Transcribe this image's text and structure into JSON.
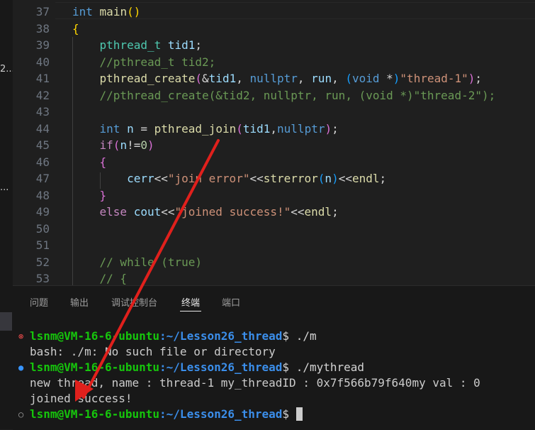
{
  "sidebar": {
    "fragments": [
      "2...",
      "..."
    ]
  },
  "editor": {
    "lines": [
      {
        "n": "37",
        "tokens": [
          [
            "int",
            "k"
          ],
          [
            " ",
            "p"
          ],
          [
            "main",
            "f"
          ],
          [
            "()",
            "py"
          ]
        ]
      },
      {
        "n": "38",
        "tokens": [
          [
            "{",
            "py"
          ]
        ]
      },
      {
        "n": "39",
        "tokens": [
          [
            "    ",
            "p"
          ],
          [
            "pthread_t",
            "t"
          ],
          [
            " ",
            "p"
          ],
          [
            "tid1",
            "v"
          ],
          [
            ";",
            "p"
          ]
        ]
      },
      {
        "n": "40",
        "tokens": [
          [
            "    ",
            "p"
          ],
          [
            "//pthread_t tid2;",
            "c"
          ]
        ]
      },
      {
        "n": "41",
        "tokens": [
          [
            "    ",
            "p"
          ],
          [
            "pthread_create",
            "f"
          ],
          [
            "(",
            "pb"
          ],
          [
            "&",
            "p"
          ],
          [
            "tid1",
            "v"
          ],
          [
            ", ",
            "p"
          ],
          [
            "nullptr",
            "k"
          ],
          [
            ", ",
            "p"
          ],
          [
            "run",
            "v"
          ],
          [
            ", ",
            "p"
          ],
          [
            "(",
            "pbl"
          ],
          [
            "void",
            "k"
          ],
          [
            " *",
            "p"
          ],
          [
            ")",
            "pbl"
          ],
          [
            "\"thread-1\"",
            "s"
          ],
          [
            ")",
            "pb"
          ],
          [
            ";",
            "p"
          ]
        ]
      },
      {
        "n": "42",
        "tokens": [
          [
            "    ",
            "p"
          ],
          [
            "//pthread_create(&tid2, nullptr, run, (void *)\"thread-2\");",
            "c"
          ]
        ]
      },
      {
        "n": "43",
        "tokens": []
      },
      {
        "n": "44",
        "tokens": [
          [
            "    ",
            "p"
          ],
          [
            "int",
            "k"
          ],
          [
            " ",
            "p"
          ],
          [
            "n",
            "v"
          ],
          [
            " = ",
            "p"
          ],
          [
            "pthread_join",
            "f"
          ],
          [
            "(",
            "pb"
          ],
          [
            "tid1",
            "v"
          ],
          [
            ",",
            "p"
          ],
          [
            "nullptr",
            "k"
          ],
          [
            ")",
            "pb"
          ],
          [
            ";",
            "p"
          ]
        ]
      },
      {
        "n": "45",
        "tokens": [
          [
            "    ",
            "p"
          ],
          [
            "if",
            "kc"
          ],
          [
            "(",
            "pb"
          ],
          [
            "n",
            "v"
          ],
          [
            "!=",
            "p"
          ],
          [
            "0",
            "n"
          ],
          [
            ")",
            "pb"
          ]
        ]
      },
      {
        "n": "46",
        "tokens": [
          [
            "    ",
            "p"
          ],
          [
            "{",
            "pb"
          ]
        ]
      },
      {
        "n": "47",
        "tokens": [
          [
            "        ",
            "p"
          ],
          [
            "cerr",
            "v"
          ],
          [
            "<<",
            "p"
          ],
          [
            "\"join error\"",
            "s"
          ],
          [
            "<<",
            "p"
          ],
          [
            "strerror",
            "f"
          ],
          [
            "(",
            "pbl"
          ],
          [
            "n",
            "v"
          ],
          [
            ")",
            "pbl"
          ],
          [
            "<<",
            "p"
          ],
          [
            "endl",
            "f"
          ],
          [
            ";",
            "p"
          ]
        ]
      },
      {
        "n": "48",
        "tokens": [
          [
            "    ",
            "p"
          ],
          [
            "}",
            "pb"
          ]
        ]
      },
      {
        "n": "49",
        "tokens": [
          [
            "    ",
            "p"
          ],
          [
            "else",
            "kc"
          ],
          [
            " ",
            "p"
          ],
          [
            "cout",
            "v"
          ],
          [
            "<<",
            "p"
          ],
          [
            "\"joined success!\"",
            "s"
          ],
          [
            "<<",
            "p"
          ],
          [
            "endl",
            "f"
          ],
          [
            ";",
            "p"
          ]
        ]
      },
      {
        "n": "50",
        "tokens": []
      },
      {
        "n": "51",
        "tokens": []
      },
      {
        "n": "52",
        "tokens": [
          [
            "    ",
            "p"
          ],
          [
            "// while (true)",
            "c"
          ]
        ]
      },
      {
        "n": "53",
        "tokens": [
          [
            "    ",
            "p"
          ],
          [
            "// {",
            "c"
          ]
        ]
      }
    ]
  },
  "panel": {
    "tabs": [
      {
        "label": "问题",
        "active": false
      },
      {
        "label": "输出",
        "active": false
      },
      {
        "label": "调试控制台",
        "active": false
      },
      {
        "label": "终端",
        "active": true
      },
      {
        "label": "端口",
        "active": false
      }
    ]
  },
  "terminal": {
    "lines": [
      {
        "decoration": "error",
        "user": "lsnm@VM-16-6-ubuntu",
        "path": ":~/Lesson26_thread",
        "command": "$ ./m"
      },
      {
        "text": "bash: ./m: No such file or directory"
      },
      {
        "decoration": "success",
        "user": "lsnm@VM-16-6-ubuntu",
        "path": ":~/Lesson26_thread",
        "command": "$ ./mythread"
      },
      {
        "text": "new thread, name : thread-1 my_threadID : 0x7f566b79f640my val : 0"
      },
      {
        "text": "joined success!"
      },
      {
        "decoration": "idle",
        "user": "lsnm@VM-16-6-ubuntu",
        "path": ":~/Lesson26_thread",
        "command": "$ ",
        "cursor": true
      }
    ]
  },
  "colors": {
    "annotation_arrow": "#e0201c",
    "terminal_bg": "#181818",
    "editor_bg": "#1f1f1f"
  }
}
